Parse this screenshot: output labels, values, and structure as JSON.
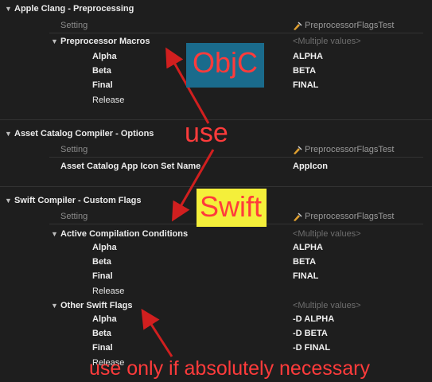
{
  "sections": {
    "clang": {
      "title": "Apple Clang - Preprocessing",
      "header_setting": "Setting",
      "header_target": "PreprocessorFlagsTest",
      "group": {
        "label": "Preprocessor Macros",
        "summary": "<Multiple values>",
        "rows": [
          {
            "name": "Alpha",
            "value": "ALPHA"
          },
          {
            "name": "Beta",
            "value": "BETA"
          },
          {
            "name": "Final",
            "value": "FINAL"
          },
          {
            "name": "Release",
            "value": ""
          }
        ]
      }
    },
    "asset": {
      "title": "Asset Catalog Compiler - Options",
      "header_setting": "Setting",
      "header_target": "PreprocessorFlagsTest",
      "row": {
        "name": "Asset Catalog App Icon Set Name",
        "value": "AppIcon"
      }
    },
    "swift": {
      "title": "Swift Compiler - Custom Flags",
      "header_setting": "Setting",
      "header_target": "PreprocessorFlagsTest",
      "acc": {
        "label": "Active Compilation Conditions",
        "summary": "<Multiple values>",
        "rows": [
          {
            "name": "Alpha",
            "value": "ALPHA"
          },
          {
            "name": "Beta",
            "value": "BETA"
          },
          {
            "name": "Final",
            "value": "FINAL"
          },
          {
            "name": "Release",
            "value": ""
          }
        ]
      },
      "osf": {
        "label": "Other Swift Flags",
        "summary": "<Multiple values>",
        "rows": [
          {
            "name": "Alpha",
            "value": "-D ALPHA"
          },
          {
            "name": "Beta",
            "value": "-D BETA"
          },
          {
            "name": "Final",
            "value": "-D FINAL"
          },
          {
            "name": "Release",
            "value": ""
          }
        ]
      }
    }
  },
  "annotations": {
    "objc": "ObjC",
    "use": "use",
    "swift": "Swift",
    "use_only": "use only if absolutely necessary",
    "color": "#ff3b3b"
  },
  "icons": {
    "disclosure": "disclosure-triangle-icon",
    "target": "build-target-icon"
  }
}
